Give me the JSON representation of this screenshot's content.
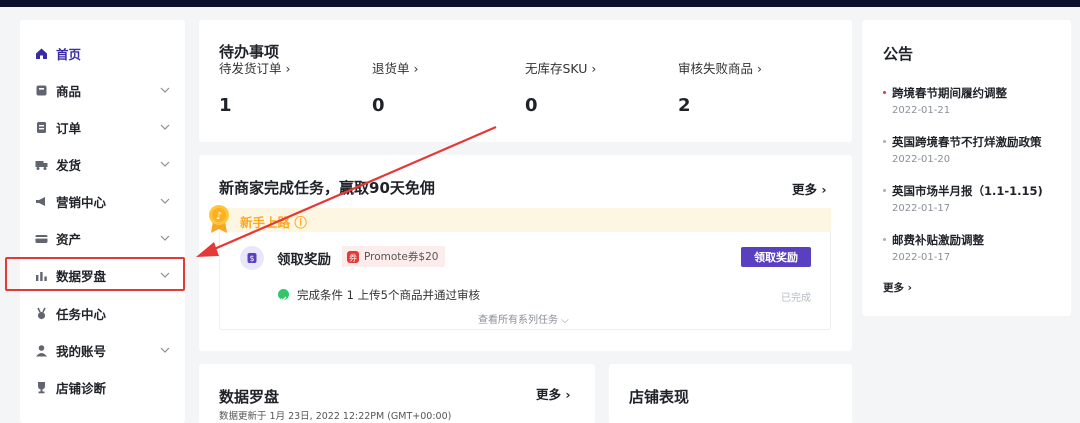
{
  "sidebar": {
    "items": [
      {
        "label": "首页",
        "icon": "home-icon",
        "active": true
      },
      {
        "label": "商品",
        "icon": "product-icon"
      },
      {
        "label": "订单",
        "icon": "order-icon"
      },
      {
        "label": "发货",
        "icon": "truck-icon"
      },
      {
        "label": "营销中心",
        "icon": "megaphone-icon"
      },
      {
        "label": "资产",
        "icon": "card-icon"
      },
      {
        "label": "数据罗盘",
        "icon": "bar-chart-icon",
        "highlighted": true
      },
      {
        "label": "任务中心",
        "icon": "medal-icon"
      },
      {
        "label": "我的账号",
        "icon": "user-icon"
      },
      {
        "label": "店铺诊断",
        "icon": "trophy-icon"
      }
    ]
  },
  "todo": {
    "title": "待办事项",
    "items": [
      {
        "label": "待发货订单 ›",
        "value": "1"
      },
      {
        "label": "退货单 ›",
        "value": "0"
      },
      {
        "label": "无库存SKU ›",
        "value": "0"
      },
      {
        "label": "审核失败商品 ›",
        "value": "2"
      }
    ]
  },
  "task": {
    "title": "新商家完成任务，赢取90天免佣",
    "more": "更多 ›",
    "banner": "新手上路 ⓘ",
    "reward_title": "领取奖励",
    "promo": "Promote券$20",
    "claim_button": "领取奖励",
    "condition": "完成条件 1  上传5个商品并通过审核",
    "status": "已完成",
    "view_all": "查看所有系列任务 ⌵"
  },
  "notice": {
    "title": "公告",
    "items": [
      {
        "title": "跨境春节期间履约调整",
        "date": "2022-01-21",
        "unread": true
      },
      {
        "title": "英国跨境春节不打烊激励政策",
        "date": "2022-01-20"
      },
      {
        "title": "英国市场半月报（1.1-1.15)",
        "date": "2022-01-17"
      },
      {
        "title": "邮费补贴激励调整",
        "date": "2022-01-17"
      }
    ],
    "more": "更多 ›"
  },
  "compass": {
    "title": "数据罗盘",
    "more": "更多 ›",
    "updated": "数据更新于 1月 23日, 2022 12:22PM (GMT+00:00)"
  },
  "store": {
    "title": "店铺表现"
  },
  "colors": {
    "accent": "#5a3fc0",
    "highlight_red": "#e53935",
    "banner_orange": "#ffa81e",
    "topbar": "#0c0f2e"
  }
}
